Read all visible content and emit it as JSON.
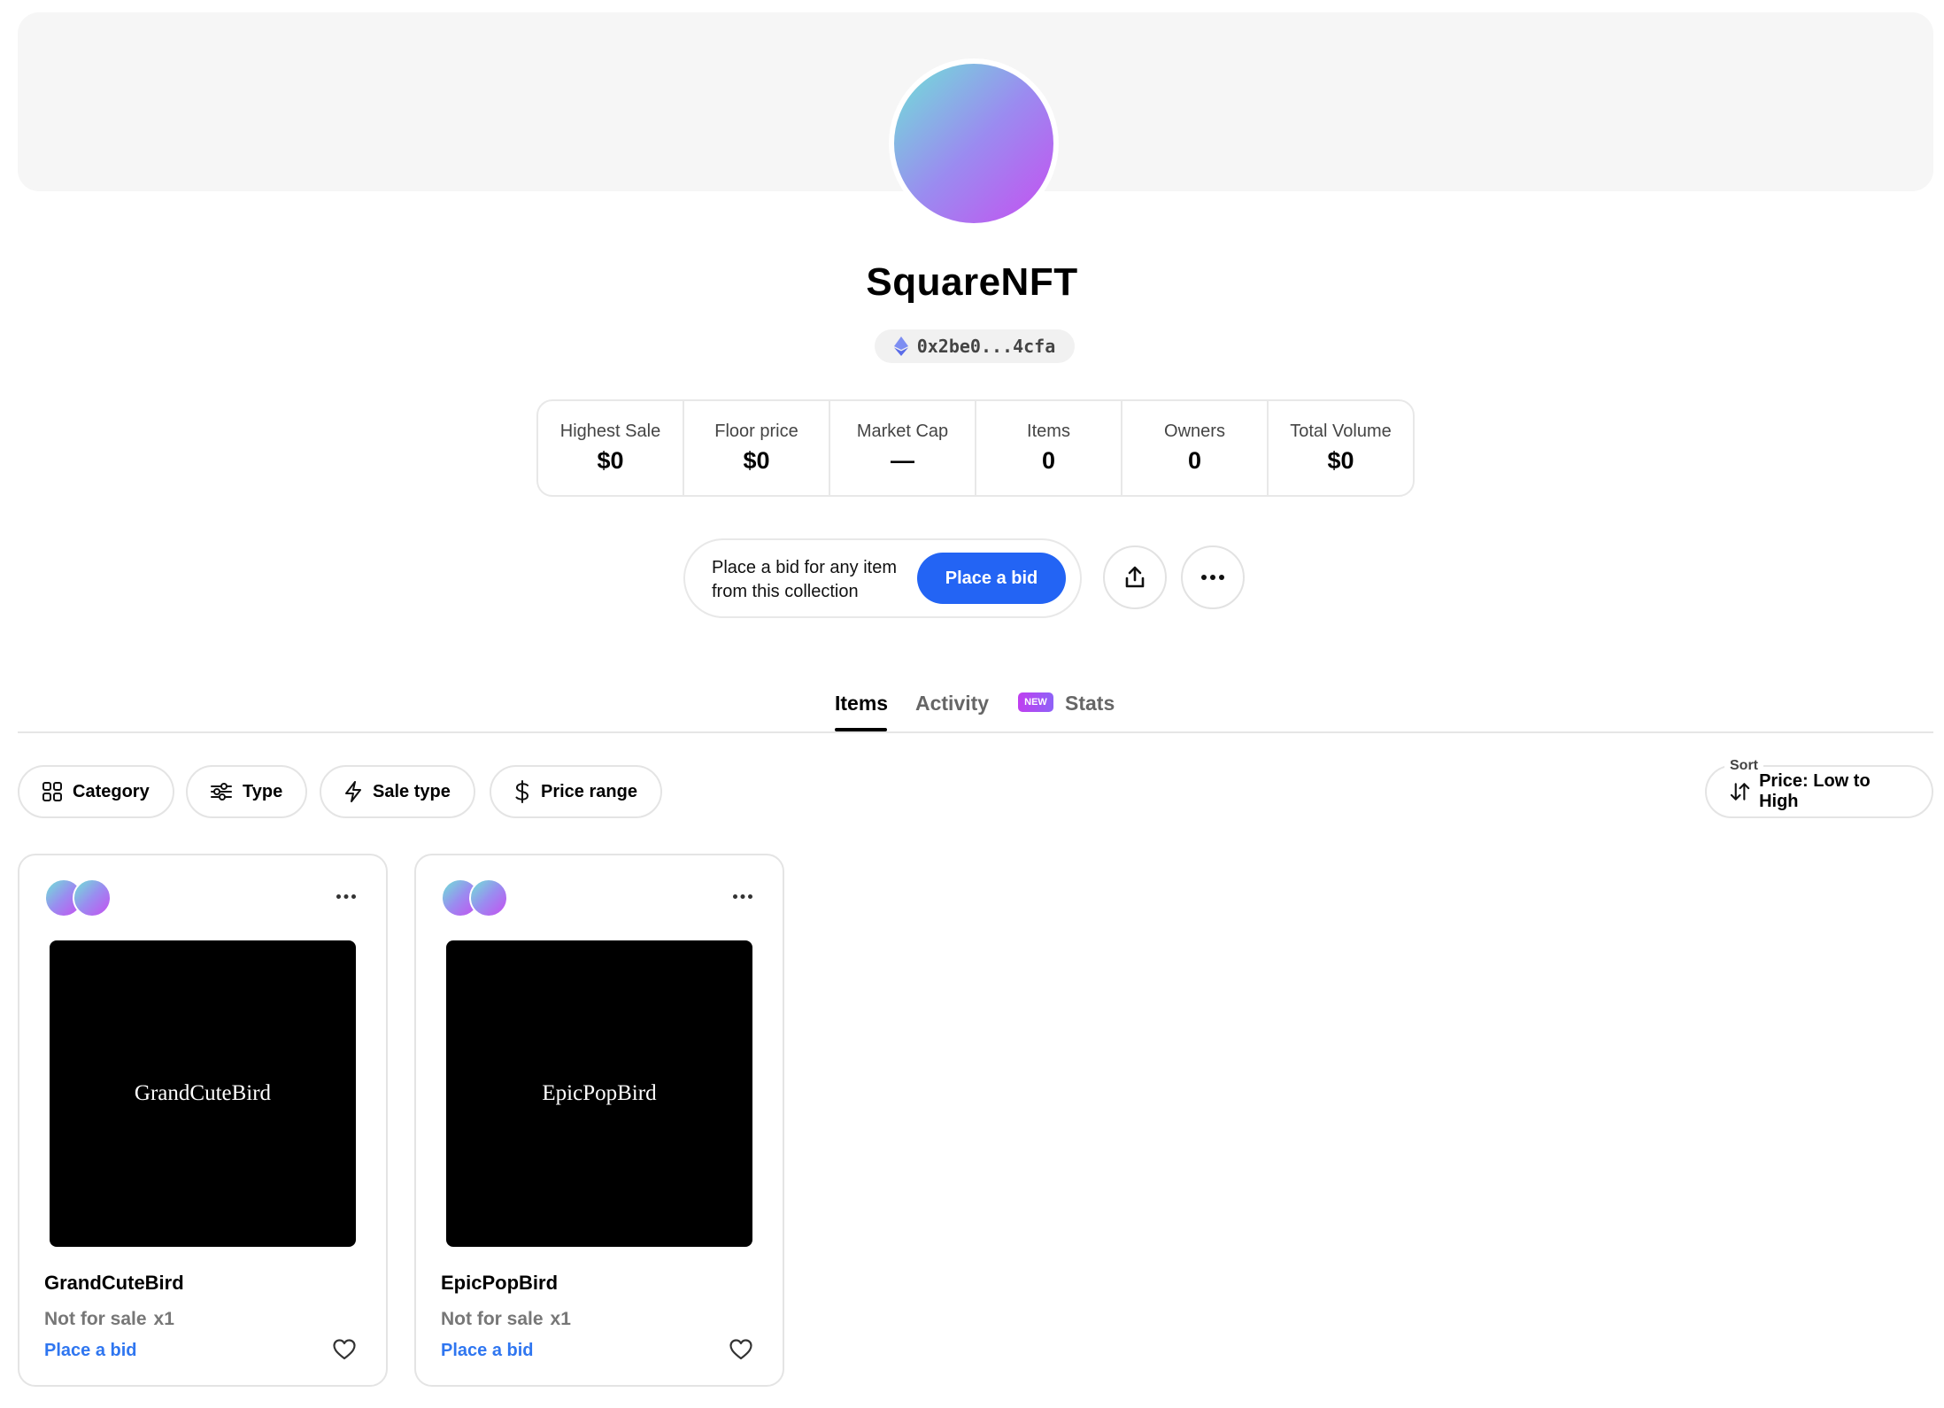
{
  "collection": {
    "name": "SquareNFT",
    "address": "0x2be0...4cfa"
  },
  "stats": [
    {
      "label": "Highest Sale",
      "value": "$0"
    },
    {
      "label": "Floor price",
      "value": "$0"
    },
    {
      "label": "Market Cap",
      "value": "—"
    },
    {
      "label": "Items",
      "value": "0"
    },
    {
      "label": "Owners",
      "value": "0"
    },
    {
      "label": "Total Volume",
      "value": "$0"
    }
  ],
  "bid_cta": {
    "text_line1": "Place a bid for any item",
    "text_line2": "from this collection",
    "button_label": "Place a bid"
  },
  "tabs": {
    "items": "Items",
    "activity": "Activity",
    "new_badge": "NEW",
    "stats": "Stats"
  },
  "filters": {
    "category": "Category",
    "type": "Type",
    "sale_type": "Sale type",
    "price_range": "Price range"
  },
  "sort": {
    "label": "Sort",
    "value": "Price: Low to High"
  },
  "cards": [
    {
      "name": "GrandCuteBird",
      "image_text": "GrandCuteBird",
      "status": "Not for sale",
      "quantity": "x1",
      "action": "Place a bid"
    },
    {
      "name": "EpicPopBird",
      "image_text": "EpicPopBird",
      "status": "Not for sale",
      "quantity": "x1",
      "action": "Place a bid"
    }
  ],
  "colors": {
    "accent": "#2364f4",
    "link": "#2f76f0",
    "gradient_start": "#6fe3d6",
    "gradient_end": "#c64ff1"
  }
}
